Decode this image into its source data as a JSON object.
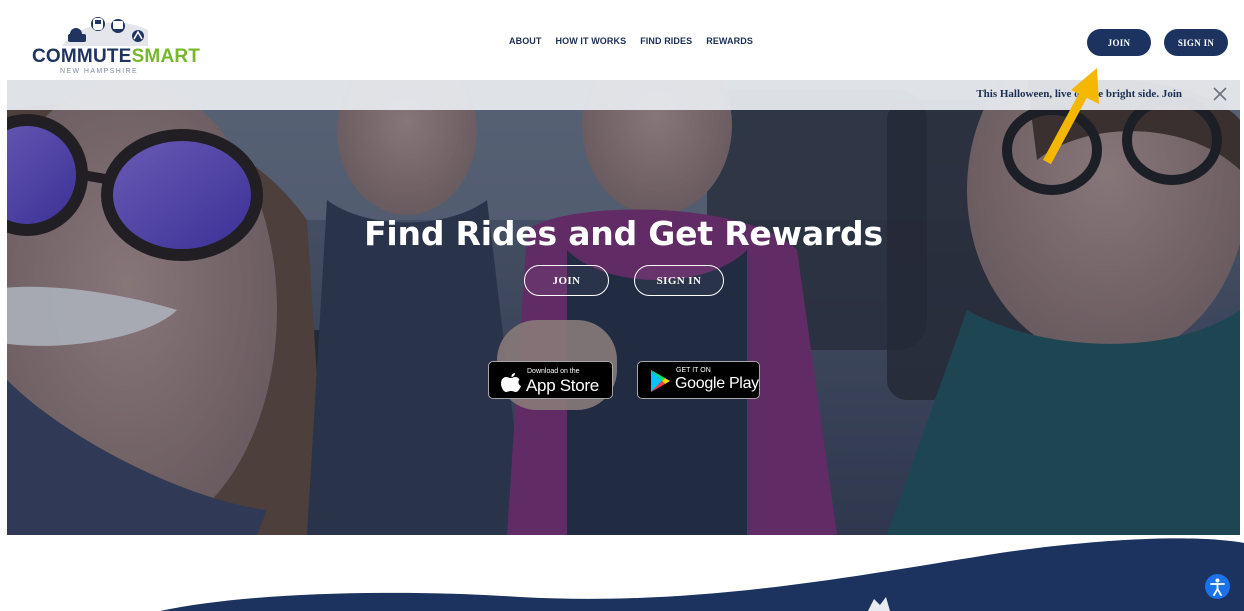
{
  "brand": {
    "name_part1": "COMMUTE",
    "name_part2": "SMART",
    "state": "NEW HAMPSHIRE",
    "primary_color": "#1c3360",
    "accent_color": "#76b82a"
  },
  "nav": {
    "items": [
      {
        "label": "ABOUT"
      },
      {
        "label": "HOW IT WORKS"
      },
      {
        "label": "FIND RIDES"
      },
      {
        "label": "REWARDS"
      }
    ]
  },
  "header_buttons": {
    "join": "JOIN",
    "sign_in": "SIGN IN"
  },
  "banner": {
    "message": "This Halloween, live on the bright side. Join",
    "close_icon": "close-icon"
  },
  "hero": {
    "title": "Find Rides and Get Rewards",
    "join": "JOIN",
    "sign_in": "SIGN IN"
  },
  "app_badges": {
    "apple_small": "Download on the",
    "apple_big": "App Store",
    "google_small": "GET IT ON",
    "google_big": "Google Play"
  },
  "annotation": {
    "arrow_color": "#f5b800"
  },
  "accessibility": {
    "icon": "accessibility-icon",
    "color": "#1a73e8"
  }
}
